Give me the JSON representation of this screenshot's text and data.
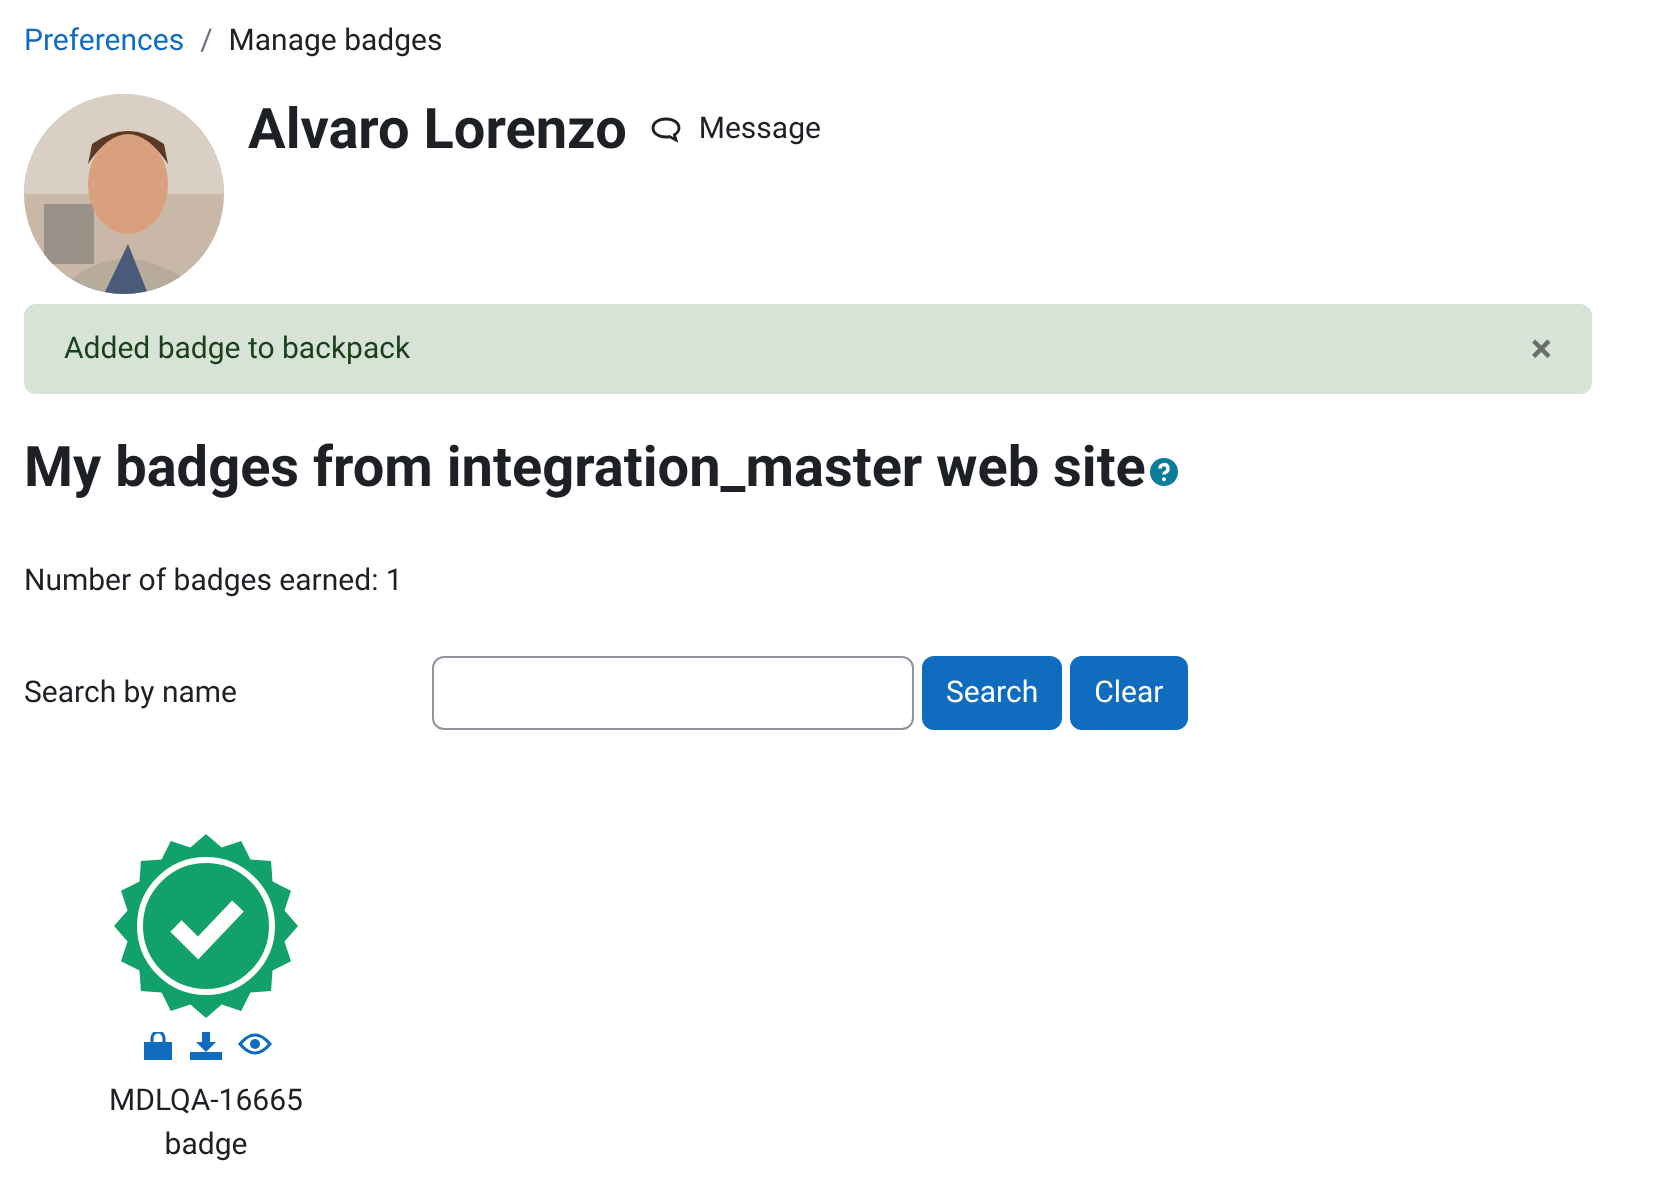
{
  "breadcrumb": [
    {
      "label": "Preferences",
      "kind": "link"
    },
    {
      "label": "Manage badges",
      "kind": "current",
      "separator": "/"
    }
  ],
  "profile": {
    "name": "Alvaro Lorenzo",
    "message_label": "Message"
  },
  "alert": {
    "text": "Added badge to backpack",
    "close": "×"
  },
  "heading": "My badges from integration_master web site",
  "count_text": "Number of badges earned: 1",
  "search": {
    "label": "Search by name",
    "buttons": [
      "Search",
      "Clear"
    ]
  },
  "badges": [
    {
      "name": "MDLQA-16665 badge",
      "color": "#12a06b"
    }
  ]
}
